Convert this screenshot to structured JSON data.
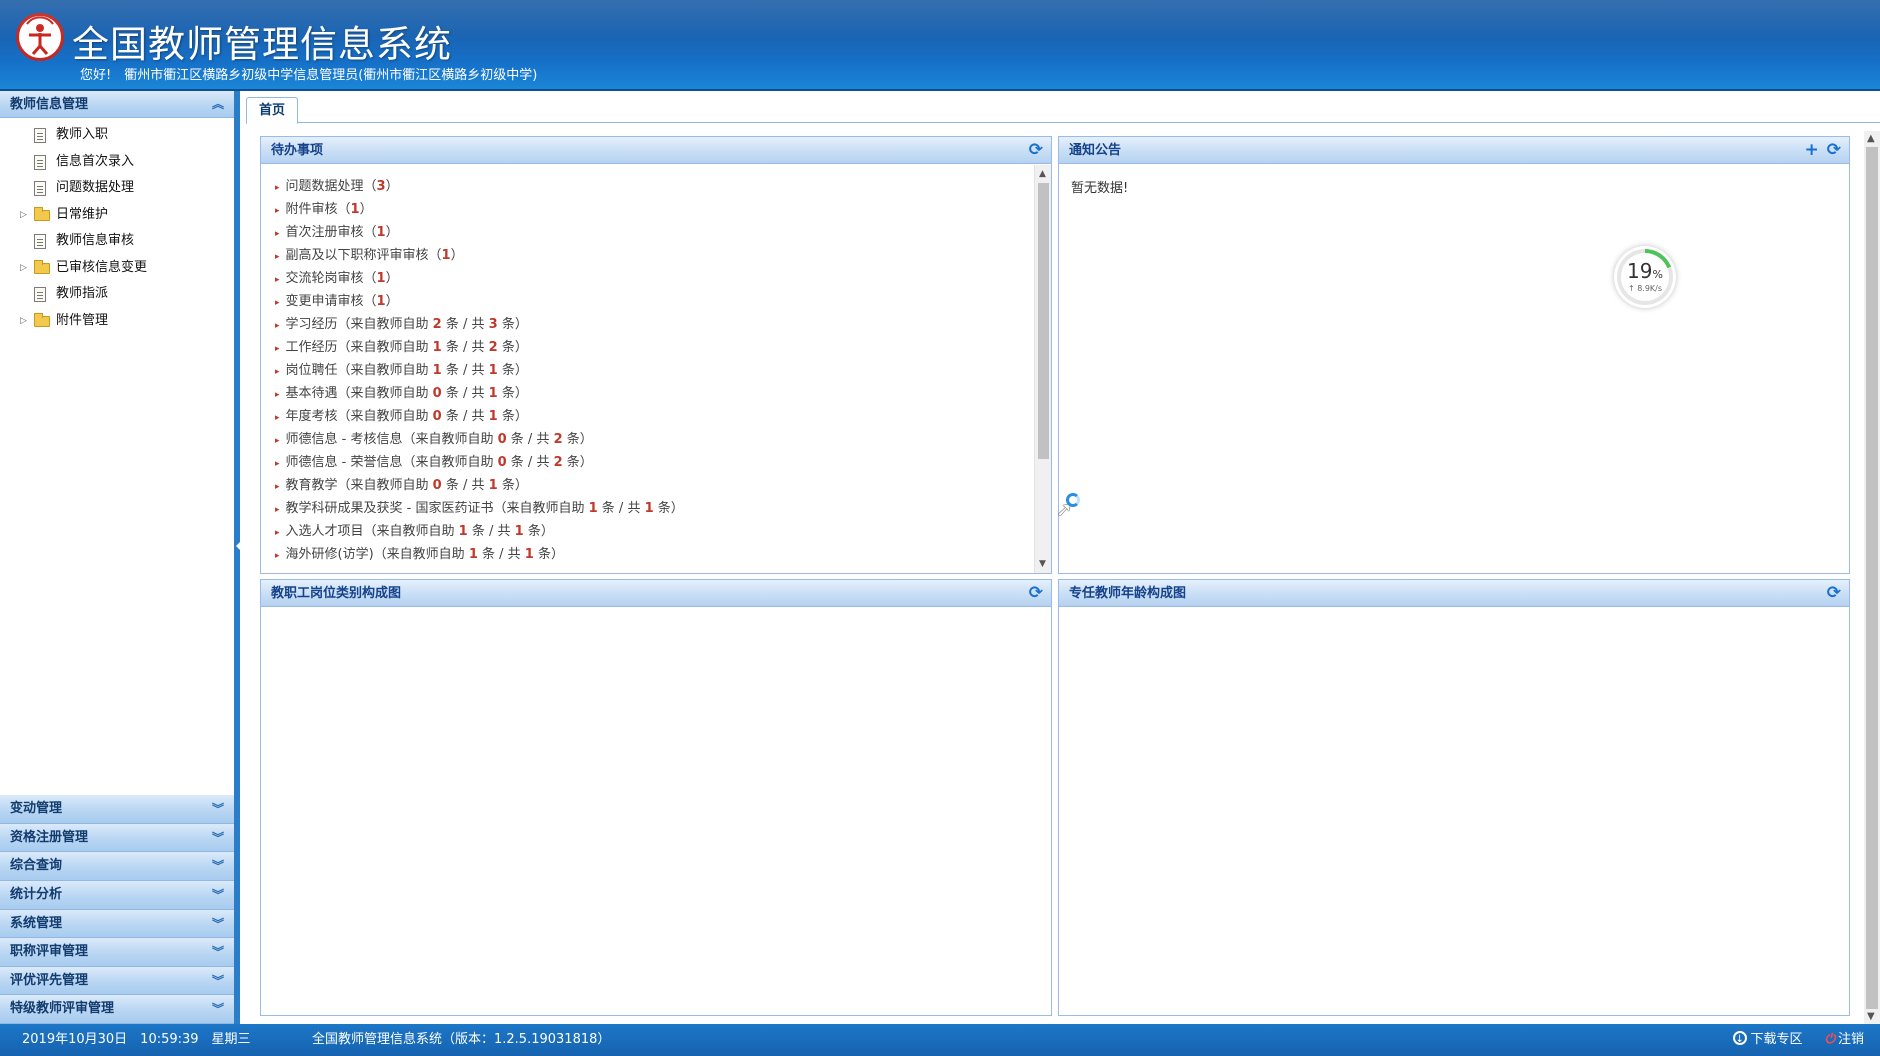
{
  "header": {
    "title": "全国教师管理信息系统",
    "greeting": "您好!　衢州市衢江区横路乡初级中学信息管理员(衢州市衢江区横路乡初级中学)"
  },
  "sidebar": {
    "active_section": "教师信息管理",
    "tree": [
      {
        "label": "教师入职",
        "kind": "doc"
      },
      {
        "label": "信息首次录入",
        "kind": "doc"
      },
      {
        "label": "问题数据处理",
        "kind": "doc"
      },
      {
        "label": "日常维护",
        "kind": "folder"
      },
      {
        "label": "教师信息审核",
        "kind": "doc"
      },
      {
        "label": "已审核信息变更",
        "kind": "folder"
      },
      {
        "label": "教师指派",
        "kind": "doc"
      },
      {
        "label": "附件管理",
        "kind": "folder"
      }
    ],
    "sections": [
      "变动管理",
      "资格注册管理",
      "综合查询",
      "统计分析",
      "系统管理",
      "职称评审管理",
      "评优评先管理",
      "特级教师评审管理"
    ]
  },
  "tabs": [
    "首页"
  ],
  "panels": {
    "todo": {
      "title": "待办事项",
      "items": [
        {
          "pre": "问题数据处理（",
          "n1": "3",
          "mid": "）",
          "n2": "",
          "post": ""
        },
        {
          "pre": "附件审核（",
          "n1": "1",
          "mid": "）",
          "n2": "",
          "post": ""
        },
        {
          "pre": "首次注册审核（",
          "n1": "1",
          "mid": "）",
          "n2": "",
          "post": ""
        },
        {
          "pre": "副高及以下职称评审审核（",
          "n1": "1",
          "mid": "）",
          "n2": "",
          "post": ""
        },
        {
          "pre": "交流轮岗审核（",
          "n1": "1",
          "mid": "）",
          "n2": "",
          "post": ""
        },
        {
          "pre": "变更申请审核（",
          "n1": "1",
          "mid": "）",
          "n2": "",
          "post": ""
        },
        {
          "pre": "学习经历（来自教师自助 ",
          "n1": "2",
          "mid": " 条 / 共 ",
          "n2": "3",
          "post": " 条）"
        },
        {
          "pre": "工作经历（来自教师自助 ",
          "n1": "1",
          "mid": " 条 / 共 ",
          "n2": "2",
          "post": " 条）"
        },
        {
          "pre": "岗位聘任（来自教师自助 ",
          "n1": "1",
          "mid": " 条 / 共 ",
          "n2": "1",
          "post": " 条）"
        },
        {
          "pre": "基本待遇（来自教师自助 ",
          "n1": "0",
          "mid": " 条 / 共 ",
          "n2": "1",
          "post": " 条）"
        },
        {
          "pre": "年度考核（来自教师自助 ",
          "n1": "0",
          "mid": " 条 / 共 ",
          "n2": "1",
          "post": " 条）"
        },
        {
          "pre": "师德信息 - 考核信息（来自教师自助 ",
          "n1": "0",
          "mid": " 条 / 共 ",
          "n2": "2",
          "post": " 条）"
        },
        {
          "pre": "师德信息 - 荣誉信息（来自教师自助 ",
          "n1": "0",
          "mid": " 条 / 共 ",
          "n2": "2",
          "post": " 条）"
        },
        {
          "pre": "教育教学（来自教师自助 ",
          "n1": "0",
          "mid": " 条 / 共 ",
          "n2": "1",
          "post": " 条）"
        },
        {
          "pre": "教学科研成果及获奖 - 国家医药证书（来自教师自助 ",
          "n1": "1",
          "mid": " 条 / 共 ",
          "n2": "1",
          "post": " 条）"
        },
        {
          "pre": "入选人才项目（来自教师自助 ",
          "n1": "1",
          "mid": " 条 / 共 ",
          "n2": "1",
          "post": " 条）"
        },
        {
          "pre": "海外研修(访学)（来自教师自助 ",
          "n1": "1",
          "mid": " 条 / 共 ",
          "n2": "1",
          "post": " 条）"
        }
      ]
    },
    "notice": {
      "title": "通知公告",
      "empty_text": "暂无数据!"
    },
    "post_chart": {
      "title": "教职工岗位类别构成图"
    },
    "age_chart": {
      "title": "专任教师年龄构成图"
    }
  },
  "gauge": {
    "percent": "19",
    "unit": "%",
    "speed": "↑ 8.9K/s",
    "ring_fraction": 0.19,
    "ring_color": "#4fc35b"
  },
  "footer": {
    "datetime": "2019年10月30日　10:59:39　星期三",
    "version": "全国教师管理信息系统（版本：1.2.5.19031818）",
    "download": "下载专区",
    "logout": "注销"
  },
  "colors": {
    "accent": "#1670c8",
    "number": "#c0392b",
    "panel_title": "#15428b"
  },
  "icons": {
    "refresh": "refresh-icon",
    "add": "plus-icon",
    "collapse": "double-chevron-up-icon",
    "expand": "double-chevron-down-icon"
  }
}
